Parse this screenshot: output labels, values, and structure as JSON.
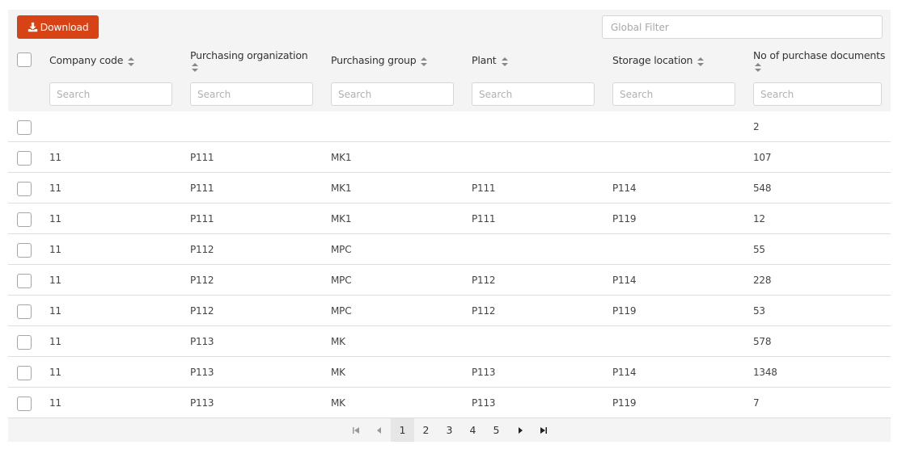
{
  "toolbar": {
    "download_label": "Download",
    "download_icon": "download-icon",
    "global_filter_placeholder": "Global Filter",
    "accent_color": "#d84315"
  },
  "columns": [
    {
      "key": "company_code",
      "label": "Company code",
      "search_placeholder": "Search",
      "sortable": true
    },
    {
      "key": "purchasing_organization",
      "label": "Purchasing organization",
      "search_placeholder": "Search",
      "sortable": true
    },
    {
      "key": "purchasing_group",
      "label": "Purchasing group",
      "search_placeholder": "Search",
      "sortable": true
    },
    {
      "key": "plant",
      "label": "Plant",
      "search_placeholder": "Search",
      "sortable": true
    },
    {
      "key": "storage_location",
      "label": "Storage location",
      "search_placeholder": "Search",
      "sortable": true
    },
    {
      "key": "no_of_purchase_documents",
      "label": "No of purchase documents",
      "search_placeholder": "Search",
      "sortable": true
    }
  ],
  "rows": [
    [
      "",
      "",
      "",
      "",
      "",
      "2"
    ],
    [
      "11",
      "P111",
      "MK1",
      "",
      "",
      "107"
    ],
    [
      "11",
      "P111",
      "MK1",
      "P111",
      "P114",
      "548"
    ],
    [
      "11",
      "P111",
      "MK1",
      "P111",
      "P119",
      "12"
    ],
    [
      "11",
      "P112",
      "MPC",
      "",
      "",
      "55"
    ],
    [
      "11",
      "P112",
      "MPC",
      "P112",
      "P114",
      "228"
    ],
    [
      "11",
      "P112",
      "MPC",
      "P112",
      "P119",
      "53"
    ],
    [
      "11",
      "P113",
      "MK",
      "",
      "",
      "578"
    ],
    [
      "11",
      "P113",
      "MK",
      "P113",
      "P114",
      "1348"
    ],
    [
      "11",
      "P113",
      "MK",
      "P113",
      "P119",
      "7"
    ]
  ],
  "pagination": {
    "pages": [
      "1",
      "2",
      "3",
      "4",
      "5"
    ],
    "current_page": "1",
    "first_icon": "first-page-icon",
    "prev_icon": "prev-page-icon",
    "next_icon": "next-page-icon",
    "last_icon": "last-page-icon"
  }
}
